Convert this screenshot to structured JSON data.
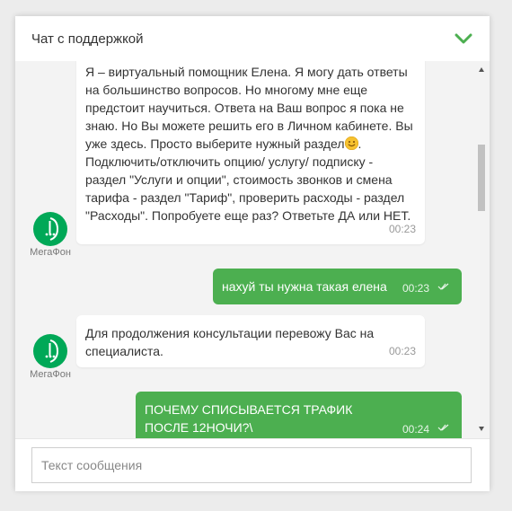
{
  "header": {
    "title": "Чат с поддержкой",
    "collapse_icon": "chevron-down-icon",
    "accent": "#4caf50"
  },
  "messages": [
    {
      "direction": "incoming",
      "sender": "МегаФон",
      "text_part1": "Я – виртуальный помощник Елена. Я могу дать ответы на большинство вопросов. Но многому мне еще предстоит научиться. Ответа на Ваш вопрос я пока не знаю. Но Вы можете решить его в Личном кабинете. Вы уже здесь. Просто выберите нужный раздел",
      "emoji": "smiling-face-emoji",
      "text_part2": ". Подключить/отключить опцию/ услугу/ подписку - раздел \"Услуги и опции\", стоимость звонков и смена тарифа - раздел \"Тариф\", проверить расходы - раздел \"Расходы\". Попробуете еще раз? Ответьте ДА или НЕТ.",
      "time": "00:23"
    },
    {
      "direction": "outgoing",
      "text": "нахуй ты нужна такая елена",
      "time": "00:23",
      "status_icon": "double-check-icon"
    },
    {
      "direction": "incoming",
      "sender": "МегаФон",
      "text": "Для продолжения консультации перевожу Вас на специалиста.",
      "time": "00:23"
    },
    {
      "direction": "outgoing",
      "text": "ПОЧЕМУ СПИСЫВАЕТСЯ ТРАФИК ПОСЛЕ 12НОЧИ?\\",
      "time": "00:24",
      "status_icon": "double-check-icon"
    }
  ],
  "input": {
    "placeholder": "Текст сообщения",
    "value": ""
  },
  "colors": {
    "incoming_bg": "#ffffff",
    "outgoing_bg": "#4caf50",
    "chat_bg": "#f3f3f3",
    "megafon_green": "#00a857"
  }
}
